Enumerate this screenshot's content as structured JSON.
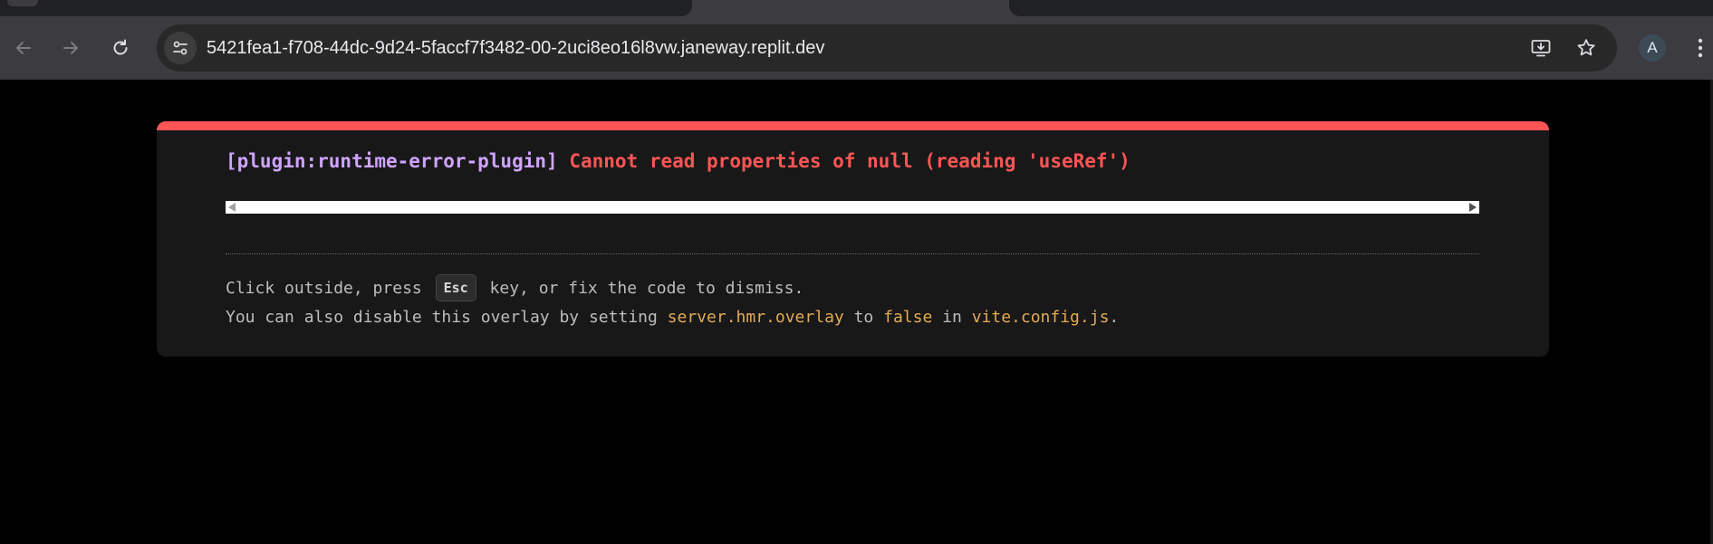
{
  "browser": {
    "url": "5421fea1-f708-44dc-9d24-5faccf7f3482-00-2uci8eo16l8vw.janeway.replit.dev",
    "profile_initial": "A",
    "icons": {
      "back": "back-arrow-icon",
      "forward": "forward-arrow-icon",
      "reload": "reload-icon",
      "site_info": "site-settings-icon",
      "install": "install-app-icon",
      "bookmark": "star-icon",
      "menu": "kebab-menu-icon"
    }
  },
  "overlay": {
    "plugin": "[plugin:runtime-error-plugin]",
    "message": "Cannot read properties of null (reading 'useRef')",
    "tip_line1": {
      "before": "Click outside, press",
      "key": "Esc",
      "after": "key, or fix the code to dismiss."
    },
    "tip_line2": {
      "part1": "You can also disable this overlay by setting",
      "code1": "server.hmr.overlay",
      "part2": "to",
      "code2": "false",
      "part3": "in",
      "code3": "vite.config.js",
      "end": "."
    },
    "colors": {
      "accent_bar": "#ff5555",
      "plugin_text": "#cfa4ff",
      "error_text": "#ff5555",
      "code_text": "#e2aa53",
      "overlay_bg": "#181818"
    }
  }
}
